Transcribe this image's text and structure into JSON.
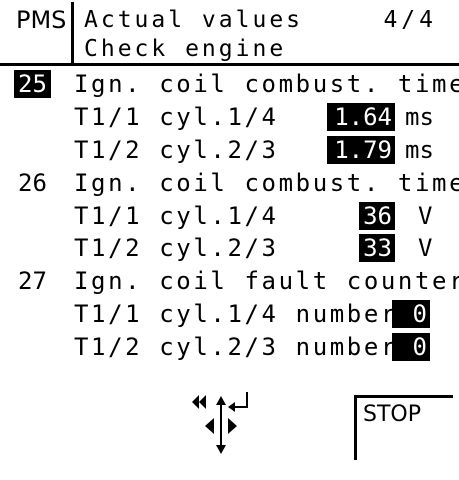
{
  "header": {
    "system": "PMS",
    "title": "Actual values",
    "page": "4/4",
    "subtitle": "Check engine"
  },
  "groups": [
    {
      "number": "25",
      "label": "Ign. coil combust. time",
      "rows": [
        {
          "label": "T1/1 cyl.1/4",
          "value": "1.64",
          "unit": "ms"
        },
        {
          "label": "T1/2 cyl.2/3",
          "value": "1.79",
          "unit": "ms"
        }
      ]
    },
    {
      "number": "26",
      "label": "Ign. coil combust. time",
      "rows": [
        {
          "label": "T1/1 cyl.1/4",
          "value": "36",
          "unit": "V"
        },
        {
          "label": "T1/2 cyl.2/3",
          "value": "33",
          "unit": "V"
        }
      ]
    },
    {
      "number": "27",
      "label": "Ign. coil fault counter",
      "rows": [
        {
          "label": "T1/1 cyl.1/4 number",
          "value": "0",
          "unit": ""
        },
        {
          "label": "T1/2 cyl.2/3 number",
          "value": "0",
          "unit": ""
        }
      ]
    }
  ],
  "softkeys": {
    "nav_icon": "navigation-arrows-icon",
    "stop_label": "STOP"
  }
}
